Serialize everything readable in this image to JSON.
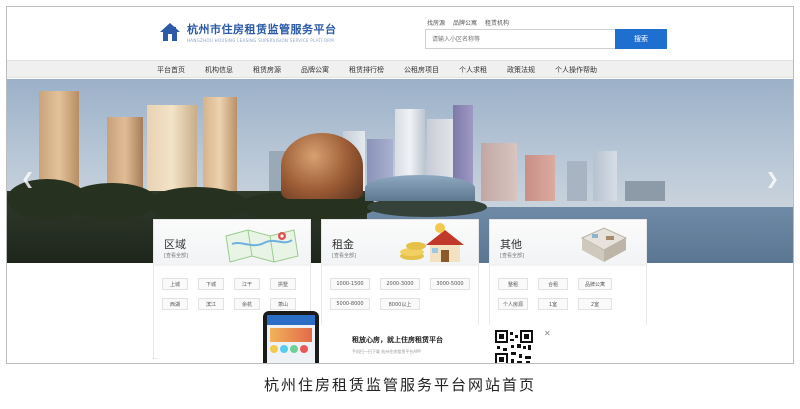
{
  "header": {
    "logo_title": "杭州市住房租赁监管服务平台",
    "logo_subtitle": "HANGZHOU HOUSING LEASING SUPERVISION SERVICE PLATFORM",
    "quick_links": [
      "找房源",
      "品牌公寓",
      "租赁机构"
    ],
    "search_placeholder": "请输入小区名称等",
    "search_button": "搜索"
  },
  "nav": {
    "items": [
      "平台首页",
      "机构信息",
      "租赁房源",
      "品牌公寓",
      "租赁排行榜",
      "公租房项目",
      "个人求租",
      "政策法规",
      "个人操作帮助"
    ]
  },
  "cards": [
    {
      "title": "区域",
      "subtitle": "[查看全部]",
      "chips": [
        "上城",
        "下城",
        "江干",
        "拱墅",
        "西湖",
        "滨江",
        "余杭",
        "萧山"
      ]
    },
    {
      "title": "租金",
      "subtitle": "[查看全部]",
      "chips": [
        "1000-1500",
        "2000-3000",
        "3000-5000",
        "5000-8000",
        "8000以上"
      ]
    },
    {
      "title": "其他",
      "subtitle": "[查看全部]",
      "chips": [
        "整租",
        "合租",
        "品牌公寓",
        "个人房源",
        "1室",
        "2室"
      ]
    }
  ],
  "promo": {
    "title": "租放心房，就上住房租赁平台",
    "subtitle": "手机扫一扫下载 杭州住房租赁平台APP"
  },
  "caption": "杭州住房租赁监管服务平台网站首页",
  "colors": {
    "brand_blue": "#2b5aa8",
    "button_blue": "#1f6fd0"
  },
  "icons": [
    "house-logo-icon",
    "chevron-left-icon",
    "chevron-right-icon",
    "map-icon",
    "coins-house-icon",
    "floorplan-icon",
    "qr-code-icon",
    "close-icon"
  ]
}
